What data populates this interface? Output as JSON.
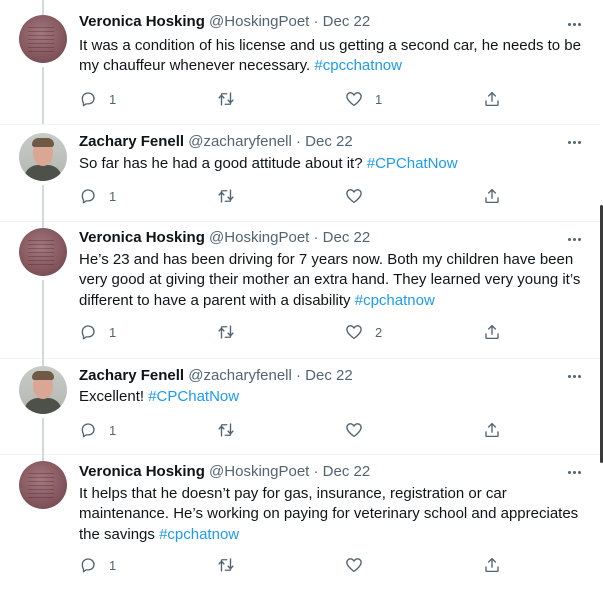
{
  "tweets": [
    {
      "name": "Veronica Hosking",
      "handle": "@HoskingPoet",
      "sep": "·",
      "date": "Dec 22",
      "text": "It was a condition of his license and us getting a second car, he needs to be my chauffeur whenever necessary.",
      "hashtag": "#cpcchatnow",
      "replies": "1",
      "retweets": "",
      "likes": "1"
    },
    {
      "name": "Zachary Fenell",
      "handle": "@zacharyfenell",
      "sep": "·",
      "date": "Dec 22",
      "text": "So far has he had a good attitude about it?",
      "hashtag": "#CPChatNow",
      "replies": "1",
      "retweets": "",
      "likes": ""
    },
    {
      "name": "Veronica Hosking",
      "handle": "@HoskingPoet",
      "sep": "·",
      "date": "Dec 22",
      "text": "He’s 23 and has been driving for 7 years now. Both my children have been very good at giving their mother an extra hand. They learned very young it’s different to have a parent with a disability",
      "hashtag": "#cpchatnow",
      "replies": "1",
      "retweets": "",
      "likes": "2"
    },
    {
      "name": "Zachary Fenell",
      "handle": "@zacharyfenell",
      "sep": "·",
      "date": "Dec 22",
      "text": "Excellent!",
      "hashtag": "#CPChatNow",
      "replies": "1",
      "retweets": "",
      "likes": ""
    },
    {
      "name": "Veronica Hosking",
      "handle": "@HoskingPoet",
      "sep": "·",
      "date": "Dec 22",
      "text": "It helps that he doesn’t pay for gas, insurance, registration or car maintenance. He’s working on paying for veterinary school and appreciates the savings",
      "hashtag": "#cpchatnow",
      "replies": "1",
      "retweets": "",
      "likes": ""
    }
  ],
  "icons": {
    "reply": "reply-icon",
    "retweet": "retweet-icon",
    "like": "heart-icon",
    "share": "share-icon",
    "more": "more-icon"
  },
  "colors": {
    "link": "#1d9bf0",
    "secondary_text": "#536471",
    "primary_text": "#0f1419"
  }
}
